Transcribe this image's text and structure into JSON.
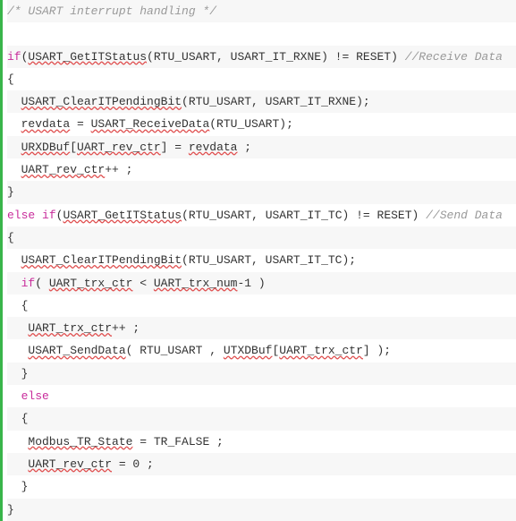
{
  "lines": [
    {
      "alt": true,
      "tokens": [
        {
          "cls": "tok-comment",
          "t": "/* USART interrupt handling */"
        }
      ]
    },
    {
      "alt": false,
      "tokens": []
    },
    {
      "alt": true,
      "tokens": [
        {
          "cls": "tok-keyword",
          "t": "if"
        },
        {
          "cls": "tok-punct",
          "t": "("
        },
        {
          "cls": "tok-err",
          "t": "USART_GetITStatus"
        },
        {
          "cls": "tok-punct",
          "t": "(RTU_USART, USART_IT_RXNE) != RESET) "
        },
        {
          "cls": "tok-comment",
          "t": "//Receive Data"
        }
      ]
    },
    {
      "alt": false,
      "tokens": [
        {
          "cls": "tok-punct",
          "t": "{"
        }
      ]
    },
    {
      "alt": true,
      "tokens": [
        {
          "cls": "tok-punct",
          "t": "  "
        },
        {
          "cls": "tok-err",
          "t": "USART_ClearITPendingBit"
        },
        {
          "cls": "tok-punct",
          "t": "(RTU_USART, USART_IT_RXNE);"
        }
      ]
    },
    {
      "alt": false,
      "tokens": [
        {
          "cls": "tok-punct",
          "t": "  "
        },
        {
          "cls": "tok-err",
          "t": "revdata"
        },
        {
          "cls": "tok-punct",
          "t": " = "
        },
        {
          "cls": "tok-err",
          "t": "USART_ReceiveData"
        },
        {
          "cls": "tok-punct",
          "t": "(RTU_USART);"
        }
      ]
    },
    {
      "alt": true,
      "tokens": [
        {
          "cls": "tok-punct",
          "t": "  "
        },
        {
          "cls": "tok-err",
          "t": "URXDBuf"
        },
        {
          "cls": "tok-punct",
          "t": "["
        },
        {
          "cls": "tok-err",
          "t": "UART_rev_ctr"
        },
        {
          "cls": "tok-punct",
          "t": "] = "
        },
        {
          "cls": "tok-err",
          "t": "revdata"
        },
        {
          "cls": "tok-punct",
          "t": " ;"
        }
      ]
    },
    {
      "alt": false,
      "tokens": [
        {
          "cls": "tok-punct",
          "t": "  "
        },
        {
          "cls": "tok-err",
          "t": "UART_rev_ctr"
        },
        {
          "cls": "tok-punct",
          "t": "++ ;"
        }
      ]
    },
    {
      "alt": true,
      "tokens": [
        {
          "cls": "tok-punct",
          "t": "}"
        }
      ]
    },
    {
      "alt": false,
      "tokens": [
        {
          "cls": "tok-keyword",
          "t": "else"
        },
        {
          "cls": "tok-punct",
          "t": " "
        },
        {
          "cls": "tok-keyword",
          "t": "if"
        },
        {
          "cls": "tok-punct",
          "t": "("
        },
        {
          "cls": "tok-err",
          "t": "USART_GetITStatus"
        },
        {
          "cls": "tok-punct",
          "t": "(RTU_USART, USART_IT_TC) != RESET) "
        },
        {
          "cls": "tok-comment",
          "t": "//Send Data"
        }
      ]
    },
    {
      "alt": true,
      "tokens": [
        {
          "cls": "tok-punct",
          "t": "{"
        }
      ]
    },
    {
      "alt": false,
      "tokens": [
        {
          "cls": "tok-punct",
          "t": "  "
        },
        {
          "cls": "tok-err",
          "t": "USART_ClearITPendingBit"
        },
        {
          "cls": "tok-punct",
          "t": "(RTU_USART, USART_IT_TC);"
        }
      ]
    },
    {
      "alt": true,
      "tokens": [
        {
          "cls": "tok-punct",
          "t": "  "
        },
        {
          "cls": "tok-keyword",
          "t": "if"
        },
        {
          "cls": "tok-punct",
          "t": "( "
        },
        {
          "cls": "tok-err",
          "t": "UART_trx_ctr"
        },
        {
          "cls": "tok-punct",
          "t": " < "
        },
        {
          "cls": "tok-err",
          "t": "UART_trx_num"
        },
        {
          "cls": "tok-punct",
          "t": "-1 )"
        }
      ]
    },
    {
      "alt": false,
      "tokens": [
        {
          "cls": "tok-punct",
          "t": "  {"
        }
      ]
    },
    {
      "alt": true,
      "tokens": [
        {
          "cls": "tok-punct",
          "t": "   "
        },
        {
          "cls": "tok-err",
          "t": "UART_trx_ctr"
        },
        {
          "cls": "tok-punct",
          "t": "++ ;"
        }
      ]
    },
    {
      "alt": false,
      "tokens": [
        {
          "cls": "tok-punct",
          "t": "   "
        },
        {
          "cls": "tok-err",
          "t": "USART_SendData"
        },
        {
          "cls": "tok-punct",
          "t": "( RTU_USART , "
        },
        {
          "cls": "tok-err",
          "t": "UTXDBuf"
        },
        {
          "cls": "tok-punct",
          "t": "["
        },
        {
          "cls": "tok-err",
          "t": "UART_trx_ctr"
        },
        {
          "cls": "tok-punct",
          "t": "] );"
        }
      ]
    },
    {
      "alt": true,
      "tokens": [
        {
          "cls": "tok-punct",
          "t": "  }"
        }
      ]
    },
    {
      "alt": false,
      "tokens": [
        {
          "cls": "tok-punct",
          "t": "  "
        },
        {
          "cls": "tok-keyword",
          "t": "else"
        }
      ]
    },
    {
      "alt": true,
      "tokens": [
        {
          "cls": "tok-punct",
          "t": "  {"
        }
      ]
    },
    {
      "alt": false,
      "tokens": [
        {
          "cls": "tok-punct",
          "t": "   "
        },
        {
          "cls": "tok-err",
          "t": "Modbus_TR_State"
        },
        {
          "cls": "tok-punct",
          "t": " = TR_FALSE ;"
        }
      ]
    },
    {
      "alt": true,
      "tokens": [
        {
          "cls": "tok-punct",
          "t": "   "
        },
        {
          "cls": "tok-err",
          "t": "UART_rev_ctr"
        },
        {
          "cls": "tok-punct",
          "t": " = 0 ;"
        }
      ]
    },
    {
      "alt": false,
      "tokens": [
        {
          "cls": "tok-punct",
          "t": "  }"
        }
      ]
    },
    {
      "alt": true,
      "tokens": [
        {
          "cls": "tok-punct",
          "t": "}"
        }
      ]
    }
  ]
}
